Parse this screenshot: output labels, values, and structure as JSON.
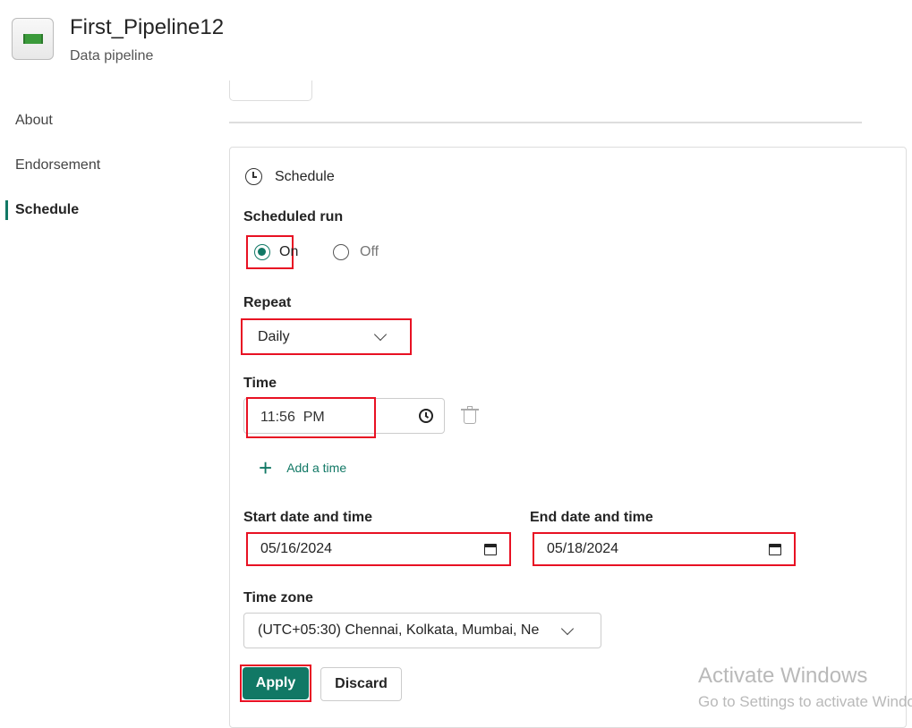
{
  "header": {
    "title": "First_Pipeline12",
    "subtitle": "Data pipeline"
  },
  "sidebar": {
    "items": [
      {
        "label": "About"
      },
      {
        "label": "Endorsement"
      },
      {
        "label": "Schedule",
        "selected": true
      }
    ]
  },
  "schedule": {
    "section_title": "Schedule",
    "scheduled_run_label": "Scheduled run",
    "on_label": "On",
    "off_label": "Off",
    "selected": "On",
    "repeat_label": "Repeat",
    "repeat_value": "Daily",
    "time_label": "Time",
    "time_value": "11:56  PM",
    "add_time_label": "Add a time",
    "start_label": "Start date and time",
    "start_value": "05/16/2024",
    "end_label": "End date and time",
    "end_value": "05/18/2024",
    "timezone_label": "Time zone",
    "timezone_value": "(UTC+05:30) Chennai, Kolkata, Mumbai, Ne",
    "apply_label": "Apply",
    "discard_label": "Discard"
  },
  "watermark": {
    "title": "Activate Windows",
    "subtitle": "Go to Settings to activate Windows."
  },
  "colors": {
    "accent": "#117865",
    "highlight": "#e81123"
  }
}
